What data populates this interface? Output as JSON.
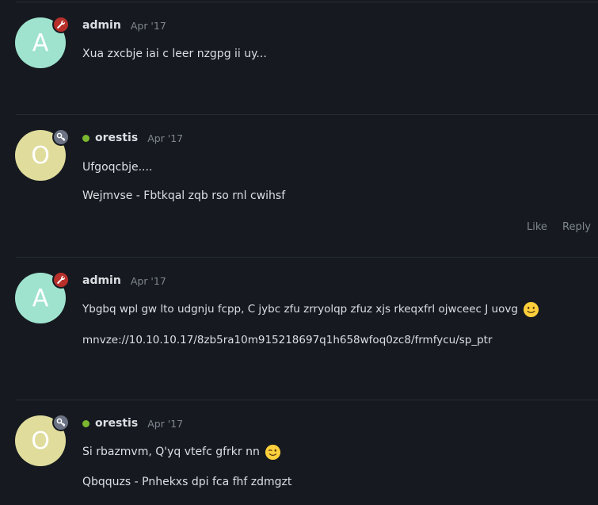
{
  "posts": [
    {
      "username": "admin",
      "date": "Apr '17",
      "avatar_letter": "A",
      "avatar_color": "#9fe3cf",
      "badge_icon": "wrench-icon",
      "badge_color": "#b7302b",
      "online": false,
      "paragraphs": [
        "Xua zxcbje iai c leer nzgpg ii uy..."
      ]
    },
    {
      "username": "orestis",
      "date": "Apr '17",
      "avatar_letter": "O",
      "avatar_color": "#e0dc9c",
      "badge_icon": "key-icon",
      "badge_color": "#6b7384",
      "online": true,
      "paragraphs": [
        "Ufgoqcbje....",
        "Wejmvse - Fbtkqal zqb rso rnl cwihsf"
      ],
      "actions": {
        "like": "Like",
        "reply": "Reply"
      }
    },
    {
      "username": "admin",
      "date": "Apr '17",
      "avatar_letter": "A",
      "avatar_color": "#9fe3cf",
      "badge_icon": "wrench-icon",
      "badge_color": "#b7302b",
      "online": false,
      "paragraphs": [
        "Ybgbq wpl gw lto udgnju fcpp, C jybc zfu zrryolqp zfuz xjs rkeqxfrl ojwceec J uovg",
        "mnvze://10.10.10.17/8zb5ra10m915218697q1h658wfoq0zc8/frmfycu/sp_ptr"
      ],
      "emoji": "slightly-smiling-face-icon"
    },
    {
      "username": "orestis",
      "date": "Apr '17",
      "avatar_letter": "O",
      "avatar_color": "#e0dc9c",
      "badge_icon": "key-icon",
      "badge_color": "#6b7384",
      "online": true,
      "paragraphs": [
        "Si rbazmvm, Q'yq vtefc gfrkr nn",
        "Qbqquzs - Pnhekxs dpi fca fhf zdmgzt"
      ],
      "emoji": "winking-face-icon"
    }
  ],
  "colors": {
    "background": "#161a20",
    "online": "#7cb82f"
  }
}
